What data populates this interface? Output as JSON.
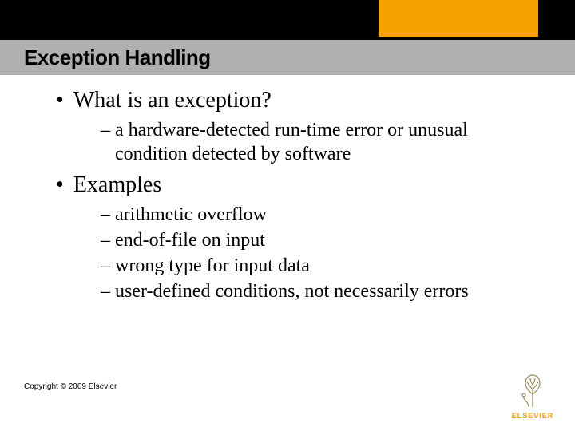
{
  "title": "Exception Handling",
  "bullets": [
    {
      "text": "What is an exception?",
      "subs": [
        "a hardware-detected run-time error or unusual condition detected by software"
      ]
    },
    {
      "text": "Examples",
      "subs": [
        "arithmetic overflow",
        "end-of-file on input",
        "wrong type for input data",
        "user-defined conditions, not necessarily errors"
      ]
    }
  ],
  "copyright": "Copyright © 2009 Elsevier",
  "logo_label": "ELSEVIER"
}
